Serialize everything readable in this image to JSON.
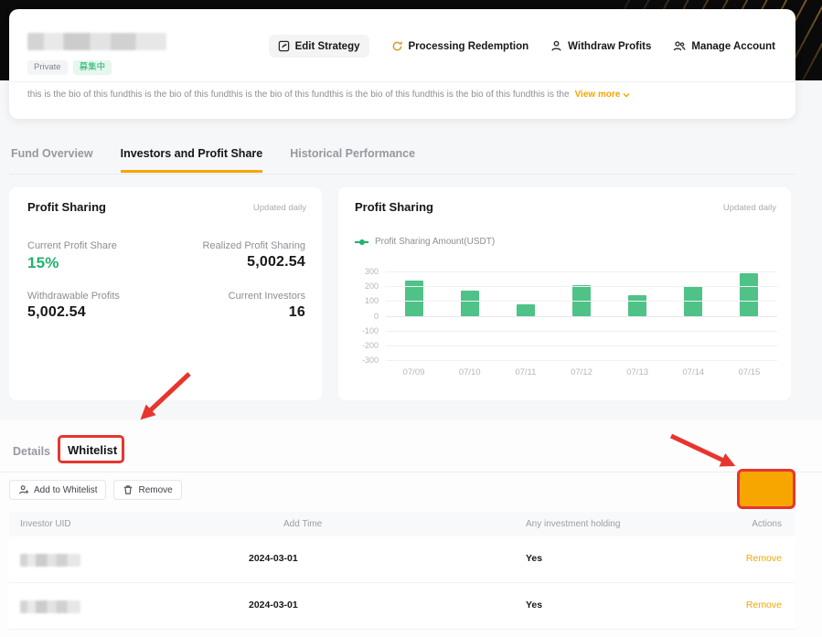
{
  "colors": {
    "accent_orange": "#f7a600",
    "green": "#20b26c",
    "bar_green": "#4ec287",
    "annotation_red": "#e8352e"
  },
  "header": {
    "tags": {
      "private": "Private",
      "status": "募集中"
    },
    "actions": [
      {
        "label": "Edit Strategy"
      },
      {
        "label": "Processing Redemption"
      },
      {
        "label": "Withdraw Profits"
      },
      {
        "label": "Manage Account"
      }
    ],
    "bio": "this is the bio of this fundthis is the bio of this fundthis is the bio of this fundthis is the bio of this fundthis is the bio of this fundthis is the",
    "view_more": "View more"
  },
  "tabs": [
    {
      "label": "Fund Overview",
      "active": false
    },
    {
      "label": "Investors and Profit Share",
      "active": true
    },
    {
      "label": "Historical Performance",
      "active": false
    }
  ],
  "profit_card": {
    "title": "Profit Sharing",
    "updated": "Updated daily",
    "stats": [
      {
        "label": "Current Profit Share",
        "value": "15%"
      },
      {
        "label": "Realized Profit Sharing",
        "value": "5,002.54"
      },
      {
        "label": "Withdrawable Profits",
        "value": "5,002.54"
      },
      {
        "label": "Current Investors",
        "value": "16"
      }
    ]
  },
  "chart_card": {
    "title": "Profit Sharing",
    "updated": "Updated daily",
    "legend": "Profit Sharing Amount(USDT)"
  },
  "chart_data": {
    "type": "bar",
    "title": "Profit Sharing",
    "legend": "Profit Sharing Amount(USDT)",
    "categories": [
      "07/09",
      "07/10",
      "07/11",
      "07/12",
      "07/13",
      "07/14",
      "07/15"
    ],
    "values": [
      240,
      170,
      80,
      210,
      140,
      200,
      290
    ],
    "ylim": [
      -300,
      300
    ],
    "yticks": [
      300,
      200,
      100,
      0,
      -100,
      -200,
      -300
    ],
    "grid": true,
    "legend_position": "top-left",
    "bar_color": "#4ec287"
  },
  "section_tabs": [
    {
      "label": "Details",
      "active": false
    },
    {
      "label": "Whitelist",
      "active": true
    }
  ],
  "toolbar": {
    "add_label": "Add to Whitelist",
    "remove_label": "Remove",
    "whitelist_toggle_on": true
  },
  "table": {
    "columns": [
      "Investor UID",
      "Add Time",
      "Any investment holding",
      "Actions"
    ],
    "rows": [
      {
        "add_time": "2024-03-01",
        "holding": "Yes",
        "action": "Remove"
      },
      {
        "add_time": "2024-03-01",
        "holding": "Yes",
        "action": "Remove"
      }
    ]
  }
}
